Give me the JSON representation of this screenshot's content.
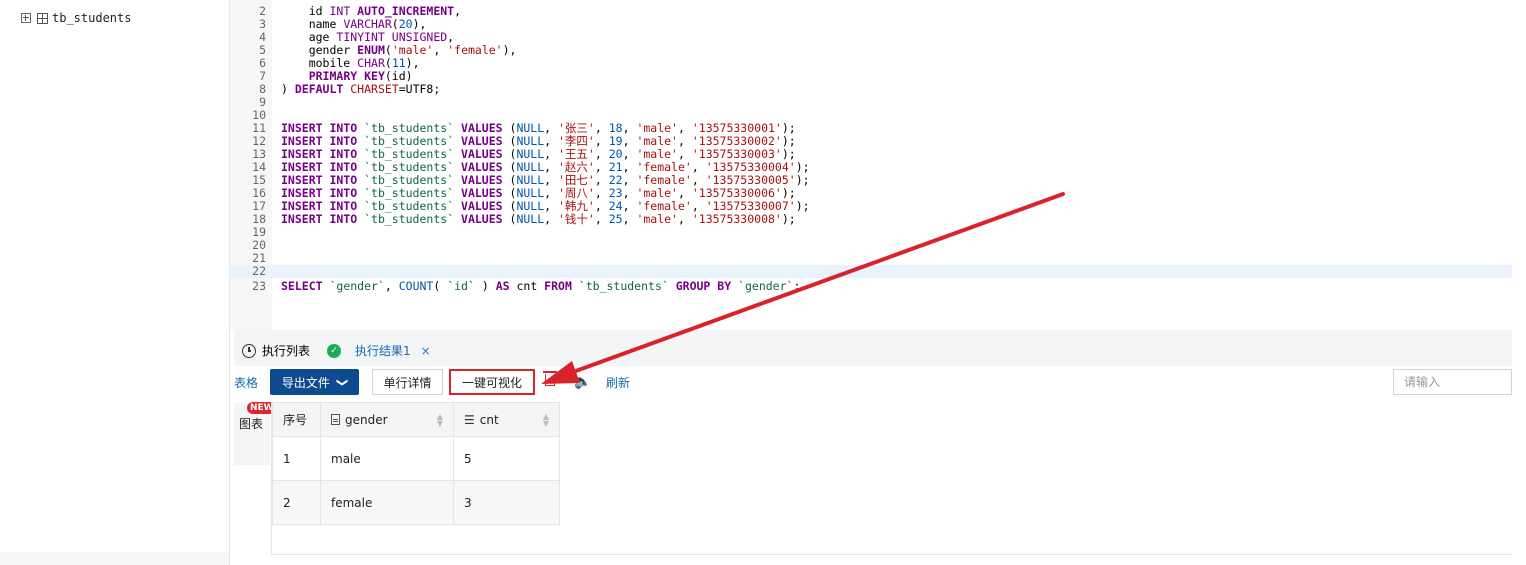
{
  "sidebar": {
    "table_item": "tb_students"
  },
  "editor": {
    "lines": [
      {
        "n": "2",
        "tokens": [
          [
            "pl",
            "    id "
          ],
          [
            "ty",
            "INT "
          ],
          [
            "kw",
            "AUTO_INCREMENT"
          ],
          [
            "pl",
            ","
          ]
        ]
      },
      {
        "n": "3",
        "tokens": [
          [
            "pl",
            "    name "
          ],
          [
            "ty",
            "VARCHAR"
          ],
          [
            "pl",
            "("
          ],
          [
            "id",
            "20"
          ],
          [
            "pl",
            "),"
          ]
        ]
      },
      {
        "n": "4",
        "tokens": [
          [
            "pl",
            "    age "
          ],
          [
            "ty",
            "TINYINT UNSIGNED"
          ],
          [
            "pl",
            ","
          ]
        ]
      },
      {
        "n": "5",
        "tokens": [
          [
            "pl",
            "    gender "
          ],
          [
            "kw",
            "ENUM"
          ],
          [
            "pl",
            "("
          ],
          [
            "str",
            "'male'"
          ],
          [
            "pl",
            ", "
          ],
          [
            "str",
            "'female'"
          ],
          [
            "pl",
            "),"
          ]
        ]
      },
      {
        "n": "6",
        "tokens": [
          [
            "pl",
            "    mobile "
          ],
          [
            "ty",
            "CHAR"
          ],
          [
            "pl",
            "("
          ],
          [
            "id",
            "11"
          ],
          [
            "pl",
            "),"
          ]
        ]
      },
      {
        "n": "7",
        "tokens": [
          [
            "pl",
            "    "
          ],
          [
            "kw",
            "PRIMARY KEY"
          ],
          [
            "pl",
            "(id)"
          ]
        ]
      },
      {
        "n": "8",
        "tokens": [
          [
            "pl",
            ") "
          ],
          [
            "kw",
            "DEFAULT "
          ],
          [
            "str",
            "CHARSET"
          ],
          [
            "pl",
            "=UTF8;"
          ]
        ]
      },
      {
        "n": "9",
        "tokens": []
      },
      {
        "n": "10",
        "tokens": []
      },
      {
        "n": "11",
        "tokens": [
          [
            "kw",
            "INSERT INTO "
          ],
          [
            "bt",
            "`tb_students` "
          ],
          [
            "kw",
            "VALUES "
          ],
          [
            "pl",
            "("
          ],
          [
            "id",
            "NULL"
          ],
          [
            "pl",
            ", "
          ],
          [
            "str",
            "'张三'"
          ],
          [
            "pl",
            ", "
          ],
          [
            "id",
            "18"
          ],
          [
            "pl",
            ", "
          ],
          [
            "str",
            "'male'"
          ],
          [
            "pl",
            ", "
          ],
          [
            "str",
            "'13575330001'"
          ],
          [
            "pl",
            ");"
          ]
        ]
      },
      {
        "n": "12",
        "tokens": [
          [
            "kw",
            "INSERT INTO "
          ],
          [
            "bt",
            "`tb_students` "
          ],
          [
            "kw",
            "VALUES "
          ],
          [
            "pl",
            "("
          ],
          [
            "id",
            "NULL"
          ],
          [
            "pl",
            ", "
          ],
          [
            "str",
            "'李四'"
          ],
          [
            "pl",
            ", "
          ],
          [
            "id",
            "19"
          ],
          [
            "pl",
            ", "
          ],
          [
            "str",
            "'male'"
          ],
          [
            "pl",
            ", "
          ],
          [
            "str",
            "'13575330002'"
          ],
          [
            "pl",
            ");"
          ]
        ]
      },
      {
        "n": "13",
        "tokens": [
          [
            "kw",
            "INSERT INTO "
          ],
          [
            "bt",
            "`tb_students` "
          ],
          [
            "kw",
            "VALUES "
          ],
          [
            "pl",
            "("
          ],
          [
            "id",
            "NULL"
          ],
          [
            "pl",
            ", "
          ],
          [
            "str",
            "'王五'"
          ],
          [
            "pl",
            ", "
          ],
          [
            "id",
            "20"
          ],
          [
            "pl",
            ", "
          ],
          [
            "str",
            "'male'"
          ],
          [
            "pl",
            ", "
          ],
          [
            "str",
            "'13575330003'"
          ],
          [
            "pl",
            ");"
          ]
        ]
      },
      {
        "n": "14",
        "tokens": [
          [
            "kw",
            "INSERT INTO "
          ],
          [
            "bt",
            "`tb_students` "
          ],
          [
            "kw",
            "VALUES "
          ],
          [
            "pl",
            "("
          ],
          [
            "id",
            "NULL"
          ],
          [
            "pl",
            ", "
          ],
          [
            "str",
            "'赵六'"
          ],
          [
            "pl",
            ", "
          ],
          [
            "id",
            "21"
          ],
          [
            "pl",
            ", "
          ],
          [
            "str",
            "'female'"
          ],
          [
            "pl",
            ", "
          ],
          [
            "str",
            "'13575330004'"
          ],
          [
            "pl",
            ");"
          ]
        ]
      },
      {
        "n": "15",
        "tokens": [
          [
            "kw",
            "INSERT INTO "
          ],
          [
            "bt",
            "`tb_students` "
          ],
          [
            "kw",
            "VALUES "
          ],
          [
            "pl",
            "("
          ],
          [
            "id",
            "NULL"
          ],
          [
            "pl",
            ", "
          ],
          [
            "str",
            "'田七'"
          ],
          [
            "pl",
            ", "
          ],
          [
            "id",
            "22"
          ],
          [
            "pl",
            ", "
          ],
          [
            "str",
            "'female'"
          ],
          [
            "pl",
            ", "
          ],
          [
            "str",
            "'13575330005'"
          ],
          [
            "pl",
            ");"
          ]
        ]
      },
      {
        "n": "16",
        "tokens": [
          [
            "kw",
            "INSERT INTO "
          ],
          [
            "bt",
            "`tb_students` "
          ],
          [
            "kw",
            "VALUES "
          ],
          [
            "pl",
            "("
          ],
          [
            "id",
            "NULL"
          ],
          [
            "pl",
            ", "
          ],
          [
            "str",
            "'周八'"
          ],
          [
            "pl",
            ", "
          ],
          [
            "id",
            "23"
          ],
          [
            "pl",
            ", "
          ],
          [
            "str",
            "'male'"
          ],
          [
            "pl",
            ", "
          ],
          [
            "str",
            "'13575330006'"
          ],
          [
            "pl",
            ");"
          ]
        ]
      },
      {
        "n": "17",
        "tokens": [
          [
            "kw",
            "INSERT INTO "
          ],
          [
            "bt",
            "`tb_students` "
          ],
          [
            "kw",
            "VALUES "
          ],
          [
            "pl",
            "("
          ],
          [
            "id",
            "NULL"
          ],
          [
            "pl",
            ", "
          ],
          [
            "str",
            "'韩九'"
          ],
          [
            "pl",
            ", "
          ],
          [
            "id",
            "24"
          ],
          [
            "pl",
            ", "
          ],
          [
            "str",
            "'female'"
          ],
          [
            "pl",
            ", "
          ],
          [
            "str",
            "'13575330007'"
          ],
          [
            "pl",
            ");"
          ]
        ]
      },
      {
        "n": "18",
        "tokens": [
          [
            "kw",
            "INSERT INTO "
          ],
          [
            "bt",
            "`tb_students` "
          ],
          [
            "kw",
            "VALUES "
          ],
          [
            "pl",
            "("
          ],
          [
            "id",
            "NULL"
          ],
          [
            "pl",
            ", "
          ],
          [
            "str",
            "'钱十'"
          ],
          [
            "pl",
            ", "
          ],
          [
            "id",
            "25"
          ],
          [
            "pl",
            ", "
          ],
          [
            "str",
            "'male'"
          ],
          [
            "pl",
            ", "
          ],
          [
            "str",
            "'13575330008'"
          ],
          [
            "pl",
            ");"
          ]
        ]
      },
      {
        "n": "19",
        "tokens": []
      },
      {
        "n": "20",
        "tokens": []
      },
      {
        "n": "21",
        "tokens": []
      },
      {
        "n": "22",
        "tokens": [],
        "active": true
      },
      {
        "n": "23",
        "tokens": [
          [
            "kw",
            "SELECT "
          ],
          [
            "bt",
            "`gender`"
          ],
          [
            "pl",
            ", "
          ],
          [
            "id",
            "COUNT"
          ],
          [
            "pl",
            "( "
          ],
          [
            "bt",
            "`id`"
          ],
          [
            "pl",
            " ) "
          ],
          [
            "kw",
            "AS "
          ],
          [
            "pl",
            "cnt "
          ],
          [
            "kw",
            "FROM "
          ],
          [
            "bt",
            "`tb_students` "
          ],
          [
            "kw",
            "GROUP BY "
          ],
          [
            "bt",
            "`gender`"
          ],
          [
            "pl",
            ";"
          ]
        ]
      }
    ]
  },
  "tabs": {
    "history_label": "执行列表",
    "result_label": "执行结果1",
    "close": "×"
  },
  "toolbar": {
    "table_label": "表格",
    "export_label": "导出文件",
    "export_chevron": "❯",
    "row_detail_label": "单行详情",
    "visualize_label": "一键可视化",
    "refresh_label": "刷新",
    "search_placeholder": "请输入"
  },
  "side_tab": {
    "badge": "NEW",
    "label": "图表"
  },
  "results": {
    "headers": [
      "序号",
      "gender",
      "cnt"
    ],
    "rows": [
      [
        "1",
        "male",
        "5"
      ],
      [
        "2",
        "female",
        "3"
      ]
    ]
  },
  "colors": {
    "accent": "#0e4a8f",
    "link": "#1a66b8",
    "annotation_red": "#d9232a",
    "success": "#1aad52"
  }
}
